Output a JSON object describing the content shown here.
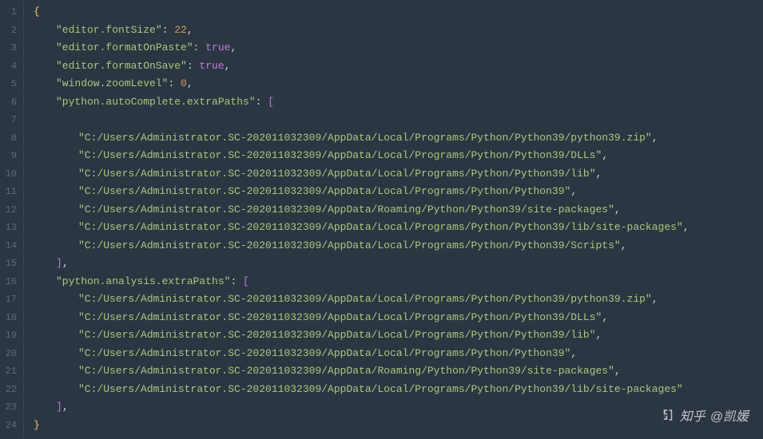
{
  "lineCount": 24,
  "json": {
    "keys": {
      "fontSize": "\"editor.fontSize\"",
      "formatOnPaste": "\"editor.formatOnPaste\"",
      "formatOnSave": "\"editor.formatOnSave\"",
      "zoomLevel": "\"window.zoomLevel\"",
      "autoCompletePaths": "\"python.autoComplete.extraPaths\"",
      "analysisPaths": "\"python.analysis.extraPaths\""
    },
    "values": {
      "fontSize": "22",
      "formatOnPaste": "true",
      "formatOnSave": "true",
      "zoomLevel": "0"
    },
    "paths1": [
      "\"C:/Users/Administrator.SC-202011032309/AppData/Local/Programs/Python/Python39/python39.zip\"",
      "\"C:/Users/Administrator.SC-202011032309/AppData/Local/Programs/Python/Python39/DLLs\"",
      "\"C:/Users/Administrator.SC-202011032309/AppData/Local/Programs/Python/Python39/lib\"",
      "\"C:/Users/Administrator.SC-202011032309/AppData/Local/Programs/Python/Python39\"",
      "\"C:/Users/Administrator.SC-202011032309/AppData/Roaming/Python/Python39/site-packages\"",
      "\"C:/Users/Administrator.SC-202011032309/AppData/Local/Programs/Python/Python39/lib/site-packages\"",
      "\"C:/Users/Administrator.SC-202011032309/AppData/Local/Programs/Python/Python39/Scripts\""
    ],
    "paths2": [
      "\"C:/Users/Administrator.SC-202011032309/AppData/Local/Programs/Python/Python39/python39.zip\"",
      "\"C:/Users/Administrator.SC-202011032309/AppData/Local/Programs/Python/Python39/DLLs\"",
      "\"C:/Users/Administrator.SC-202011032309/AppData/Local/Programs/Python/Python39/lib\"",
      "\"C:/Users/Administrator.SC-202011032309/AppData/Local/Programs/Python/Python39\"",
      "\"C:/Users/Administrator.SC-202011032309/AppData/Roaming/Python/Python39/site-packages\"",
      "\"C:/Users/Administrator.SC-202011032309/AppData/Local/Programs/Python/Python39/lib/site-packages\""
    ]
  },
  "watermark": {
    "site": "知乎",
    "author": "@凯媛"
  }
}
